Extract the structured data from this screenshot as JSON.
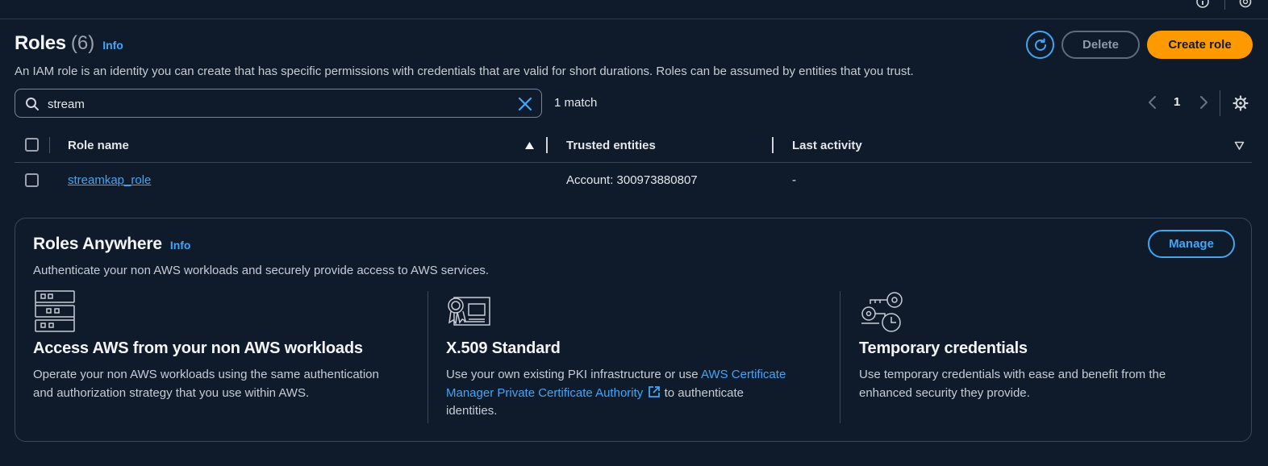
{
  "header": {
    "title": "Roles",
    "count": "(6)",
    "info_label": "Info",
    "description": "An IAM role is an identity you can create that has specific permissions with credentials that are valid for short durations. Roles can be assumed by entities that you trust.",
    "delete_label": "Delete",
    "create_label": "Create role"
  },
  "search": {
    "value": "stream",
    "match_text": "1 match"
  },
  "pagination": {
    "current_page": "1"
  },
  "table": {
    "columns": [
      "Role name",
      "Trusted entities",
      "Last activity"
    ],
    "rows": [
      {
        "role_name": "streamkap_role",
        "trusted_entities": "Account: 300973880807",
        "last_activity": "-"
      }
    ]
  },
  "roles_anywhere": {
    "title": "Roles Anywhere",
    "info_label": "Info",
    "description": "Authenticate your non AWS workloads and securely provide access to AWS services.",
    "manage_label": "Manage",
    "features": [
      {
        "icon": "server-rack-icon",
        "title": "Access AWS from your non AWS workloads",
        "desc_line1": "Operate your non AWS workloads using the same authentication",
        "desc_line2": "and authorization strategy that you use within AWS."
      },
      {
        "icon": "certificate-icon",
        "title": "X.509 Standard",
        "desc_pre": "Use your own existing PKI infrastructure or use ",
        "link_line1": "AWS Certificate",
        "link_line2": "Manager Private Certificate Authority",
        "desc_post": " to authenticate",
        "desc_line3": "identities."
      },
      {
        "icon": "keys-clock-icon",
        "title": "Temporary credentials",
        "desc_line1": "Use temporary credentials with ease and benefit from the",
        "desc_line2": "enhanced security they provide."
      }
    ]
  },
  "colors": {
    "background": "#0f1b2a",
    "accent": "#42a5f5",
    "primary_button": "#ff9900"
  }
}
